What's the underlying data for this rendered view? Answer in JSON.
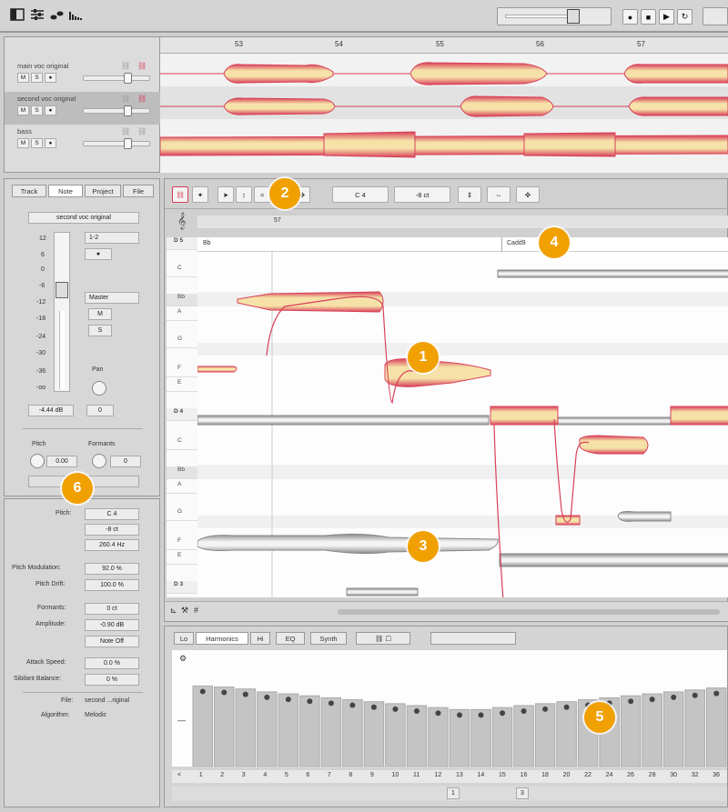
{
  "ruler": {
    "bars": [
      "53",
      "54",
      "55",
      "56",
      "57"
    ]
  },
  "tracks": [
    {
      "name": "main voc original"
    },
    {
      "name": "second voc original"
    },
    {
      "name": "bass"
    }
  ],
  "track_buttons": {
    "mute": "M",
    "solo": "S"
  },
  "inspector": {
    "tabs": [
      "Track",
      "Note",
      "Project",
      "File"
    ],
    "track_name": "second voc original",
    "scale": [
      "12",
      "6",
      "0",
      "-6",
      "-12",
      "-18",
      "-24",
      "-30",
      "-36",
      "-oo"
    ],
    "channel": "1-2",
    "output": "Master",
    "mute": "M",
    "solo": "S",
    "pan_label": "Pan",
    "volume": "-4.44 dB",
    "pan_value": "0",
    "pitch_label": "Pitch",
    "formants_label": "Formants",
    "pitch_value": "0.00",
    "formants_value": "0"
  },
  "note_props": {
    "rows": [
      {
        "label": "Pitch:",
        "value": "C 4"
      },
      {
        "label": "",
        "value": "-8 ct"
      },
      {
        "label": "",
        "value": "260.4 Hz"
      },
      {
        "label": "Pitch Modulation:",
        "value": "92.0 %"
      },
      {
        "label": "Pitch Drift:",
        "value": "100.0 %"
      },
      {
        "label": "Formants:",
        "value": "0 ct"
      },
      {
        "label": "Amplitude:",
        "value": "-0.90 dB"
      },
      {
        "label": "",
        "value": "Note Off"
      },
      {
        "label": "Attack Speed:",
        "value": "0.0 %"
      },
      {
        "label": "Sibilant Balance:",
        "value": "0 %"
      }
    ],
    "file_label": "File:",
    "file_value": "second ...riginal",
    "algorithm_label": "Algorithm:",
    "algorithm_value": "Melodic"
  },
  "editor": {
    "pitch_field": "C 4",
    "cents_field": "-8 ct",
    "bar_marker": "57",
    "chord1": "Bb",
    "chord2": "Cadd9",
    "keys": [
      "D 5",
      "C",
      "Bb",
      "A",
      "G",
      "F",
      "E",
      "D 4",
      "C",
      "Bb",
      "A",
      "G",
      "F",
      "E",
      "D 3"
    ]
  },
  "spectrum": {
    "tabs": [
      "Lo",
      "Harmonics",
      "Hi",
      "EQ",
      "Synth"
    ],
    "harmonics": [
      "1",
      "2",
      "3",
      "4",
      "5",
      "6",
      "7",
      "8",
      "9",
      "10",
      "11",
      "12",
      "13",
      "14",
      "15",
      "16",
      "18",
      "20",
      "22",
      "24",
      "26",
      "28",
      "30",
      "32",
      "36"
    ],
    "levels": [
      0.82,
      0.81,
      0.79,
      0.76,
      0.74,
      0.72,
      0.7,
      0.68,
      0.66,
      0.64,
      0.62,
      0.6,
      0.58,
      0.58,
      0.6,
      0.62,
      0.64,
      0.66,
      0.68,
      0.7,
      0.72,
      0.74,
      0.76,
      0.78,
      0.8
    ],
    "page": "1",
    "page2": "3"
  },
  "badges": [
    "1",
    "2",
    "3",
    "4",
    "5",
    "6"
  ],
  "colors": {
    "accent": "#f0a000",
    "blob_outer": "#d8405a",
    "blob_inner": "#f6e2a8",
    "gray_blob": "#8a8a8a"
  }
}
